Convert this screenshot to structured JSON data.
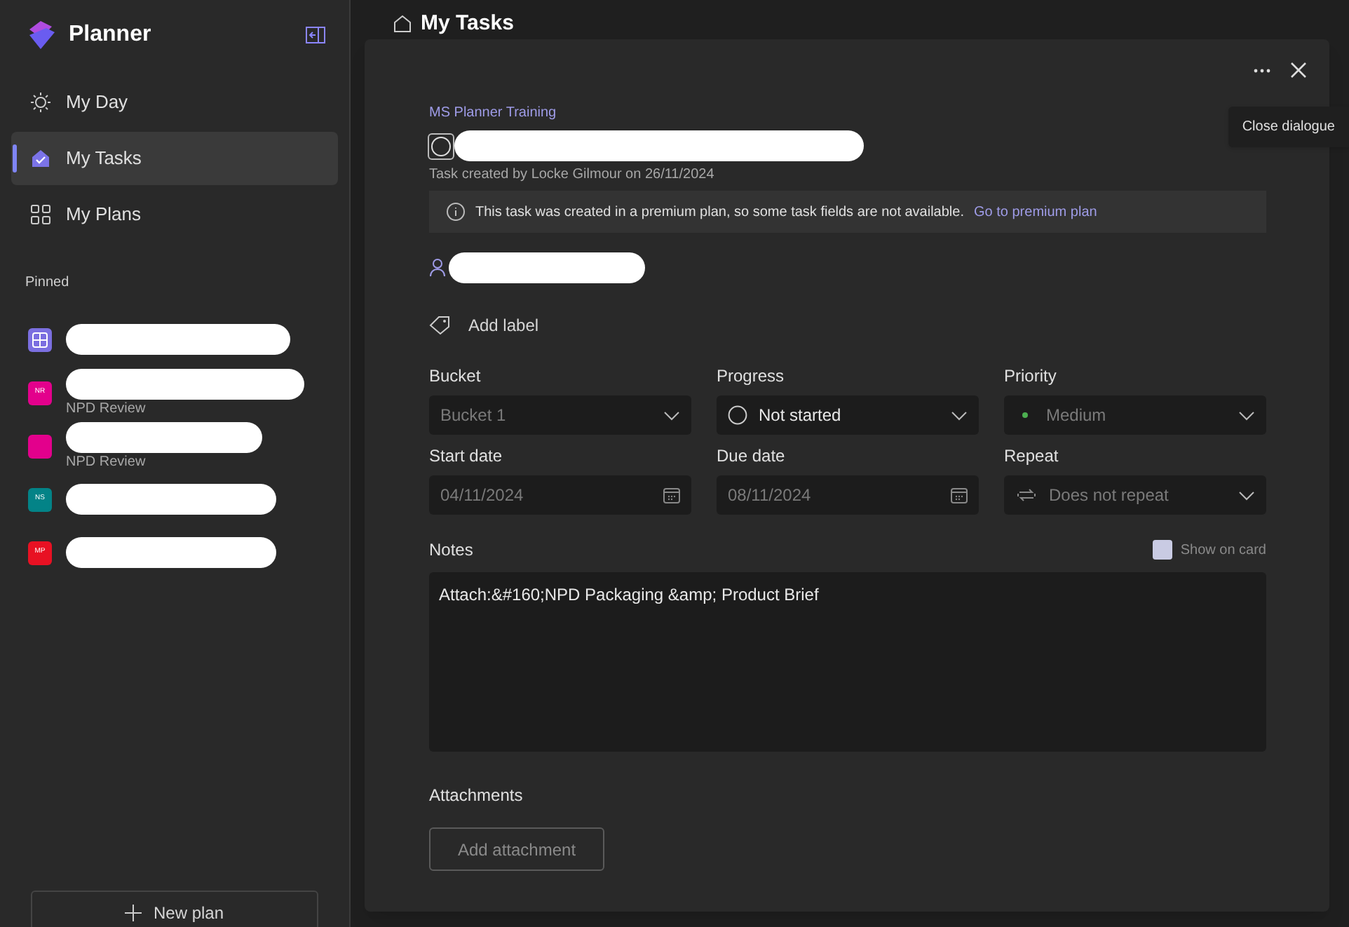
{
  "app": {
    "title": "Planner"
  },
  "nav": [
    {
      "label": "My Day",
      "selected": false
    },
    {
      "label": "My Tasks",
      "selected": true
    },
    {
      "label": "My Plans",
      "selected": false
    }
  ],
  "pinned": {
    "heading": "Pinned",
    "items": [
      {
        "kind": "icon",
        "color": "#7b6fe0"
      },
      {
        "kind": "initials",
        "initials": "NR",
        "subtitle": "NPD Review",
        "color": "#e3008c"
      },
      {
        "kind": "initials",
        "subtitle": "NPD Review",
        "color": "#e3008c"
      },
      {
        "kind": "initials",
        "initials": "NS",
        "color": "#038387"
      },
      {
        "kind": "initials",
        "initials": "MP",
        "color": "#e81123"
      }
    ]
  },
  "new_plan": "New plan",
  "page_title": "My Tasks",
  "dialog": {
    "plan": "MS Planner Training",
    "completed": false,
    "created": "Task created by Locke Gilmour on 26/11/2024",
    "banner": {
      "text": "This task was created in a premium plan, so some task fields are not available.",
      "link": "Go to premium plan"
    },
    "add_label": "Add label",
    "fields": [
      {
        "label": "Bucket",
        "value": "Bucket 1",
        "kind": "select",
        "disabled": true
      },
      {
        "label": "Progress",
        "value": "Not started",
        "kind": "progress",
        "disabled": false
      },
      {
        "label": "Priority",
        "value": "Medium",
        "kind": "priority",
        "disabled": true,
        "color": "#4caf50"
      },
      {
        "label": "Start date",
        "value": "04/11/2024",
        "kind": "date",
        "disabled": true
      },
      {
        "label": "Due date",
        "value": "08/11/2024",
        "kind": "date",
        "disabled": true
      },
      {
        "label": "Repeat",
        "value": "Does not repeat",
        "kind": "repeat",
        "disabled": true
      }
    ],
    "notes": {
      "label": "Notes",
      "show_on_card": {
        "label": "Show on card",
        "checked": false
      },
      "value": "Attach:&#160;NPD Packaging &amp; Product Brief"
    },
    "attachments": {
      "label": "Attachments",
      "button": "Add attachment"
    },
    "tooltip": "Close dialogue"
  }
}
